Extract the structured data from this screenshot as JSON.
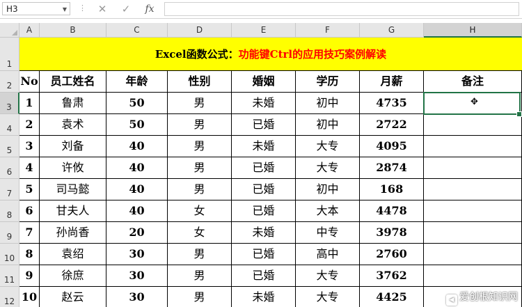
{
  "formula_bar": {
    "name_box": "H3",
    "dots": "⋮",
    "cancel_icon": "x-icon",
    "confirm_icon": "check-icon",
    "fx_label": "fx",
    "formula": ""
  },
  "columns": [
    "A",
    "B",
    "C",
    "D",
    "E",
    "F",
    "G",
    "H"
  ],
  "rows": [
    "1",
    "2",
    "3",
    "4",
    "5",
    "6",
    "7",
    "8",
    "9",
    "10",
    "11",
    "12"
  ],
  "title": {
    "part1": "Excel函数公式：",
    "part2": "功能键Ctrl的应用技巧案例解读",
    "background": "#ffff00",
    "part2_color": "#ff0000"
  },
  "table": {
    "headers": [
      "No",
      "员工姓名",
      "年龄",
      "性别",
      "婚姻",
      "学历",
      "月薪",
      "备注"
    ],
    "records": [
      [
        "1",
        "鲁肃",
        "50",
        "男",
        "未婚",
        "初中",
        "4735",
        ""
      ],
      [
        "2",
        "袁术",
        "50",
        "男",
        "已婚",
        "初中",
        "2722",
        ""
      ],
      [
        "3",
        "刘备",
        "40",
        "男",
        "未婚",
        "大专",
        "4095",
        ""
      ],
      [
        "4",
        "许攸",
        "40",
        "男",
        "已婚",
        "大专",
        "2874",
        ""
      ],
      [
        "5",
        "司马懿",
        "40",
        "男",
        "已婚",
        "初中",
        "168",
        ""
      ],
      [
        "6",
        "甘夫人",
        "40",
        "女",
        "已婚",
        "大本",
        "4478",
        ""
      ],
      [
        "7",
        "孙尚香",
        "20",
        "女",
        "未婚",
        "中专",
        "3978",
        ""
      ],
      [
        "8",
        "袁绍",
        "30",
        "男",
        "已婚",
        "高中",
        "2760",
        ""
      ],
      [
        "9",
        "徐庶",
        "30",
        "男",
        "已婚",
        "大专",
        "3762",
        ""
      ],
      [
        "10",
        "赵云",
        "30",
        "男",
        "未婚",
        "大专",
        "4425",
        ""
      ]
    ]
  },
  "selection": {
    "cell": "H3",
    "accent": "#217346"
  },
  "cursor_glyph": "✥",
  "watermark": {
    "icon": "sound-icon",
    "text": "爱创根知识网"
  }
}
